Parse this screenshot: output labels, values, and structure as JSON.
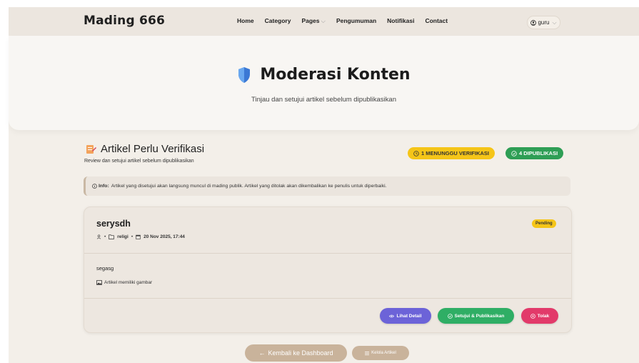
{
  "navbar": {
    "brand": "Mading 666",
    "links": [
      "Home",
      "Category",
      "Pages",
      "Pengumuman",
      "Notifikasi",
      "Contact"
    ],
    "pages_chevron": "⌵",
    "user": "guru"
  },
  "hero": {
    "title": "Moderasi Konten",
    "subtitle": "Tinjau dan setujui artikel sebelum dipublikasikan"
  },
  "section": {
    "title": "Artikel Perlu Verifikasi",
    "subtitle": "Review dan setujui artikel sebelum dipublikasikan",
    "badge_waiting": "1 MENUNGGU VERIFIKASI",
    "badge_published": "4 DIPUBLIKASI"
  },
  "info": {
    "label": "Info:",
    "text": "Artikel yang disetujui akan langsung muncul di mading publik. Artikel yang ditolak akan dikembalikan ke penulis untuk diperbaiki."
  },
  "article": {
    "title": "serysdh",
    "status": "Pending",
    "category": "religi",
    "date": "20 Nov 2025, 17:44",
    "excerpt": "segasg",
    "image_note": "Artikel memiliki gambar",
    "actions": {
      "detail": "Lihat Detail",
      "approve": "Setujui & Publikasikan",
      "reject": "Tolak"
    }
  },
  "footer_actions": {
    "back": "Kembali ke Dashboard",
    "manage": "Kelola Artikel"
  },
  "colors": {
    "accent_tan": "#c9b39b",
    "waiting": "#f5c518",
    "published": "#2e9e55",
    "detail": "#6c63d8",
    "approve": "#2fae65",
    "reject": "#e23a6a"
  },
  "icons": {
    "hero": "shield-icon",
    "section": "pencil-document-icon",
    "user": "user-circle-icon",
    "clock": "clock-icon",
    "check": "check-circle-icon",
    "info": "info-circle-icon",
    "author": "person-icon",
    "folder": "folder-icon",
    "calendar": "calendar-icon",
    "image": "image-icon",
    "eye": "eye-icon",
    "reject": "x-circle-icon",
    "back_arrow": "arrow-left-icon",
    "list": "list-icon"
  }
}
